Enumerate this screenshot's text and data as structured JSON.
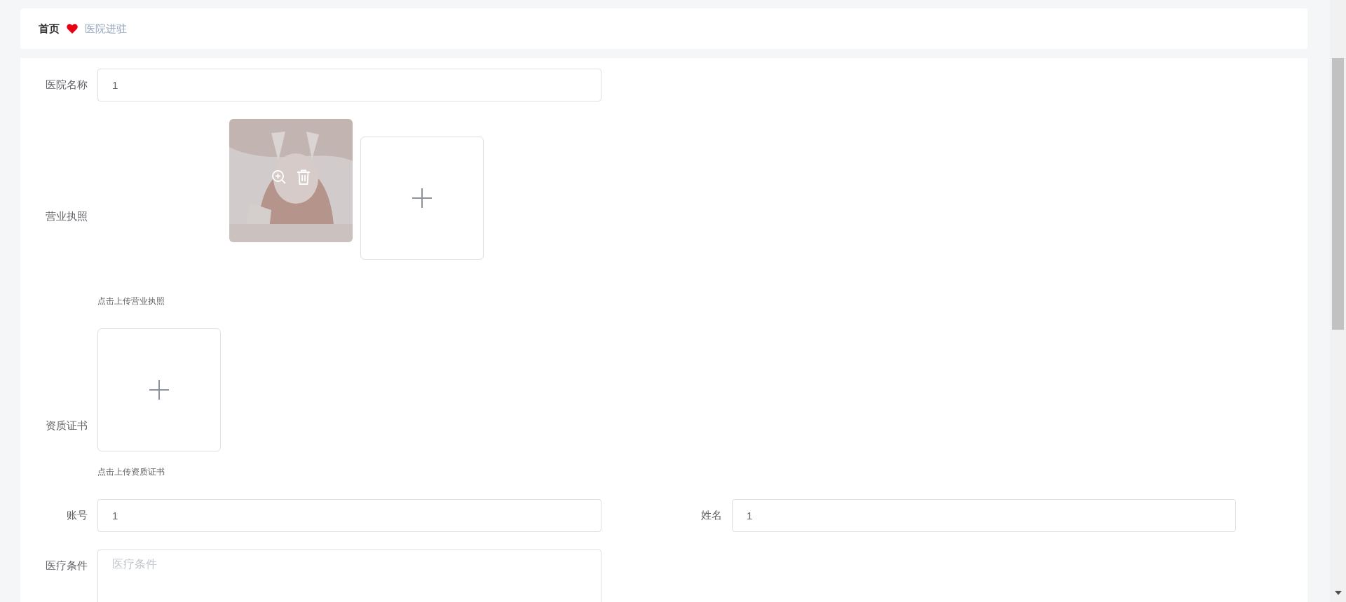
{
  "breadcrumb": [
    {
      "label": "首页",
      "current": false
    },
    {
      "label": "医院进驻",
      "current": true
    }
  ],
  "form_rows": [
    {
      "fields": [
        {
          "kind": "text",
          "label": "医院名称",
          "value": "1"
        }
      ]
    },
    {
      "fields": [
        {
          "kind": "upload",
          "label": "营业执照",
          "hint": "点击上传营业执照"
        }
      ]
    },
    {
      "fields": [
        {
          "kind": "upload",
          "label": "资质证书",
          "hint": "点击上传资质证书"
        }
      ]
    },
    {
      "fields": [
        {
          "kind": "text",
          "label": "账号",
          "value": "1"
        },
        {
          "kind": "text",
          "label": "姓名",
          "value": "1"
        }
      ]
    },
    {
      "fields": [
        {
          "kind": "textarea",
          "label": "医疗条件",
          "placeholder": "医疗条件"
        }
      ]
    }
  ]
}
